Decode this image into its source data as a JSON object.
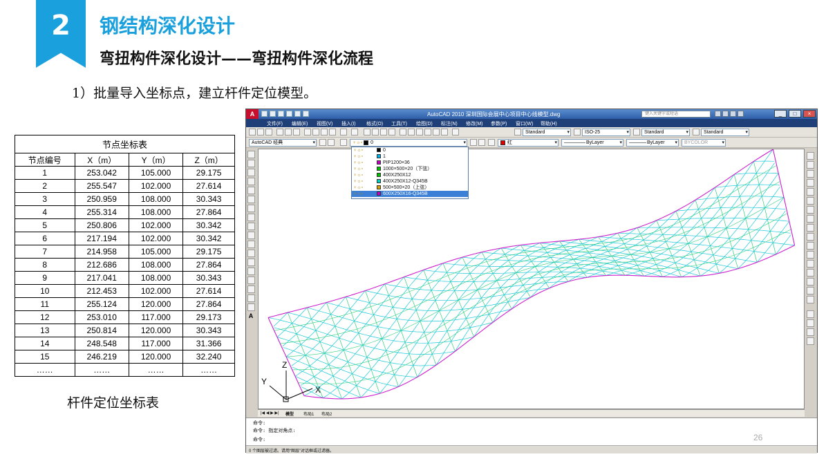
{
  "slide": {
    "section_number": "2",
    "title": "钢结构深化设计",
    "subtitle": "弯扭构件深化设计——弯扭构件深化流程",
    "step_text": "1）批量导入坐标点，建立杆件定位模型。",
    "caption": "杆件定位坐标表",
    "page_number": "26"
  },
  "table": {
    "caption": "节点坐标表",
    "headers": [
      "节点编号",
      "X（m）",
      "Y（m）",
      "Z（m）"
    ],
    "rows": [
      [
        "1",
        "253.042",
        "105.000",
        "29.175"
      ],
      [
        "2",
        "255.547",
        "102.000",
        "27.614"
      ],
      [
        "3",
        "250.959",
        "108.000",
        "30.343"
      ],
      [
        "4",
        "255.314",
        "108.000",
        "27.864"
      ],
      [
        "5",
        "250.806",
        "102.000",
        "30.342"
      ],
      [
        "6",
        "217.194",
        "102.000",
        "30.342"
      ],
      [
        "7",
        "214.958",
        "105.000",
        "29.175"
      ],
      [
        "8",
        "212.686",
        "108.000",
        "27.864"
      ],
      [
        "9",
        "217.041",
        "108.000",
        "30.343"
      ],
      [
        "10",
        "212.453",
        "102.000",
        "27.614"
      ],
      [
        "11",
        "255.124",
        "120.000",
        "27.864"
      ],
      [
        "12",
        "253.010",
        "117.000",
        "29.173"
      ],
      [
        "13",
        "250.814",
        "120.000",
        "30.343"
      ],
      [
        "14",
        "248.548",
        "117.000",
        "31.366"
      ],
      [
        "15",
        "246.219",
        "120.000",
        "32.240"
      ],
      [
        "……",
        "……",
        "……",
        "……"
      ]
    ]
  },
  "cad": {
    "logo": "A",
    "title": "AutoCAD 2010    深圳国际会展中心项目中心线模型.dwg",
    "search_placeholder": "键入关键字或短语",
    "window_buttons": [
      "_",
      "□",
      "×"
    ],
    "menu": [
      "文件(F)",
      "编辑(E)",
      "视图(V)",
      "插入(I)",
      "格式(O)",
      "工具(T)",
      "绘图(D)",
      "标注(N)",
      "修改(M)",
      "参数(P)",
      "窗口(W)",
      "帮助(H)"
    ],
    "toolbar1": {
      "text_style": "Standard",
      "dim_style": "ISO-25",
      "table_style": "Standard",
      "mleader_style": "Standard"
    },
    "toolbar2": {
      "workspace": "AutoCAD 经典",
      "current_layer": "0",
      "color": "红",
      "linetype": "ByLayer",
      "lineweight": "ByLayer",
      "plotstyle": "BYCOLOR"
    },
    "layers": [
      {
        "name": "0",
        "color": "#000000"
      },
      {
        "name": "1",
        "color": "#00b0e0"
      },
      {
        "name": "PIP1200×36",
        "color": "#c000c0"
      },
      {
        "name": "1000×500×20（下弦）",
        "color": "#00c000"
      },
      {
        "name": "400X250X12",
        "color": "#00c000"
      },
      {
        "name": "400X250X12-Q345B",
        "color": "#00d0c0"
      },
      {
        "name": "500×500×20（上弦）",
        "color": "#d4a000"
      },
      {
        "name": "600X250X16-Q345B",
        "color": "#c000c0"
      }
    ],
    "selected_layer_index": 7,
    "tabs": [
      "模型",
      "布局1",
      "布局2"
    ],
    "commands": [
      "命令:",
      "命令: 指定对角点:",
      "命令:"
    ],
    "status": "0 个图层被过滤。请用“图层”对话框或过滤器。",
    "ucs": {
      "x": "X",
      "y": "Y",
      "z": "Z"
    },
    "colors": {
      "grid_cyan": "#19c8d8",
      "grid_green": "#2bd07a",
      "member_magenta": "#d020d0"
    }
  }
}
